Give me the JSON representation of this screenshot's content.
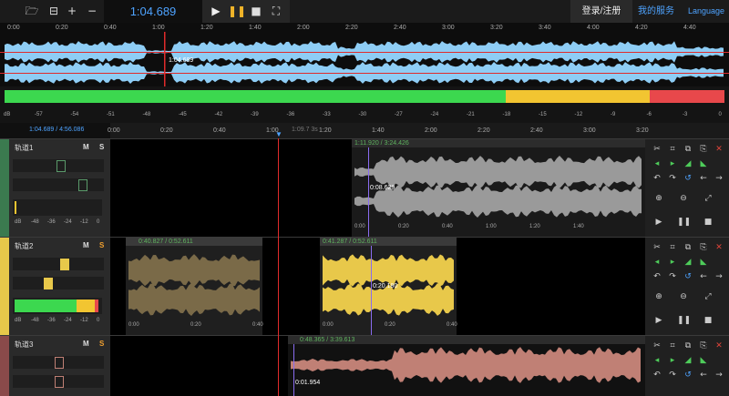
{
  "toolbar": {
    "buttons": [
      {
        "name": "open-folder-icon",
        "glyph": "🗁"
      },
      {
        "name": "export-icon",
        "glyph": "⊟"
      },
      {
        "name": "add-icon",
        "glyph": "+"
      },
      {
        "name": "remove-icon",
        "glyph": "−"
      }
    ],
    "time": "1:04.689",
    "login": "登录/注册",
    "my_service": "我的服务",
    "language": "Language"
  },
  "overview": {
    "ruler": [
      "0:00",
      "0:20",
      "0:40",
      "1:00",
      "1:20",
      "1:40",
      "2:00",
      "2:20",
      "2:40",
      "3:00",
      "3:20",
      "3:40",
      "4:00",
      "4:20",
      "4:40"
    ],
    "cursor_label": "1:04.689",
    "waveform_color": "#8ecdf5"
  },
  "meter": {
    "scale": [
      "-57",
      "-54",
      "-51",
      "-48",
      "-45",
      "-42",
      "-39",
      "-36",
      "-33",
      "-30",
      "-27",
      "-24",
      "-21",
      "-18",
      "-15",
      "-12",
      "-9",
      "-6",
      "-3",
      "0"
    ],
    "db_label": "dB"
  },
  "timeline": {
    "position": "1:04.689 / 4:56.086",
    "hover": "1:09.7 3s",
    "ticks": [
      "0:00",
      "0:20",
      "0:40",
      "1:00",
      "1:20",
      "1:40",
      "2:00",
      "2:20",
      "2:40",
      "3:00",
      "3:20"
    ]
  },
  "tracks": [
    {
      "name": "轨道1",
      "m": "M",
      "s": "S",
      "color": "#3b7a4f",
      "wave": "#9a9a9a",
      "clips": [
        {
          "info": "1:11.920 / 3:24.426",
          "pos": "0:08.629",
          "ruler": [
            "0:00",
            "0:20",
            "0:40",
            "1:00",
            "1:20",
            "1:40"
          ]
        }
      ],
      "db": [
        "dB",
        "-48",
        "-36",
        "-24",
        "-12",
        "0"
      ]
    },
    {
      "name": "轨道2",
      "m": "M",
      "s": "S",
      "color": "#e6c84a",
      "wave": "#e8c84a",
      "clips": [
        {
          "info": "0:40.827 / 0:52.611",
          "pos": "",
          "ruler": [
            "0:00",
            "0:20",
            "0:40"
          ]
        },
        {
          "info": "0:41.287 / 0:52.611",
          "pos": "0:20.180",
          "ruler": [
            "0:00",
            "0:20",
            "0:40"
          ]
        }
      ],
      "db": [
        "dB",
        "-48",
        "-36",
        "-24",
        "-12",
        "0"
      ]
    },
    {
      "name": "轨道3",
      "m": "M",
      "s": "S",
      "color": "#8a4a4a",
      "wave": "#c08075",
      "clips": [
        {
          "info": "0:48.365 / 3:39.613",
          "pos": "0:01.954",
          "ruler": []
        }
      ],
      "db": []
    }
  ],
  "tools": [
    "scissors-icon",
    "crop-icon",
    "copy-icon",
    "paste-icon",
    "close-icon",
    "move-left-icon",
    "move-right-icon",
    "fade-in-icon",
    "fade-out-icon",
    "undo-icon",
    "redo-icon",
    "reset-icon",
    "arrow-left-icon",
    "arrow-right-icon",
    "zoom-in-icon",
    "zoom-out-icon",
    "fit-icon",
    "play-icon",
    "pause-icon",
    "stop-icon"
  ]
}
